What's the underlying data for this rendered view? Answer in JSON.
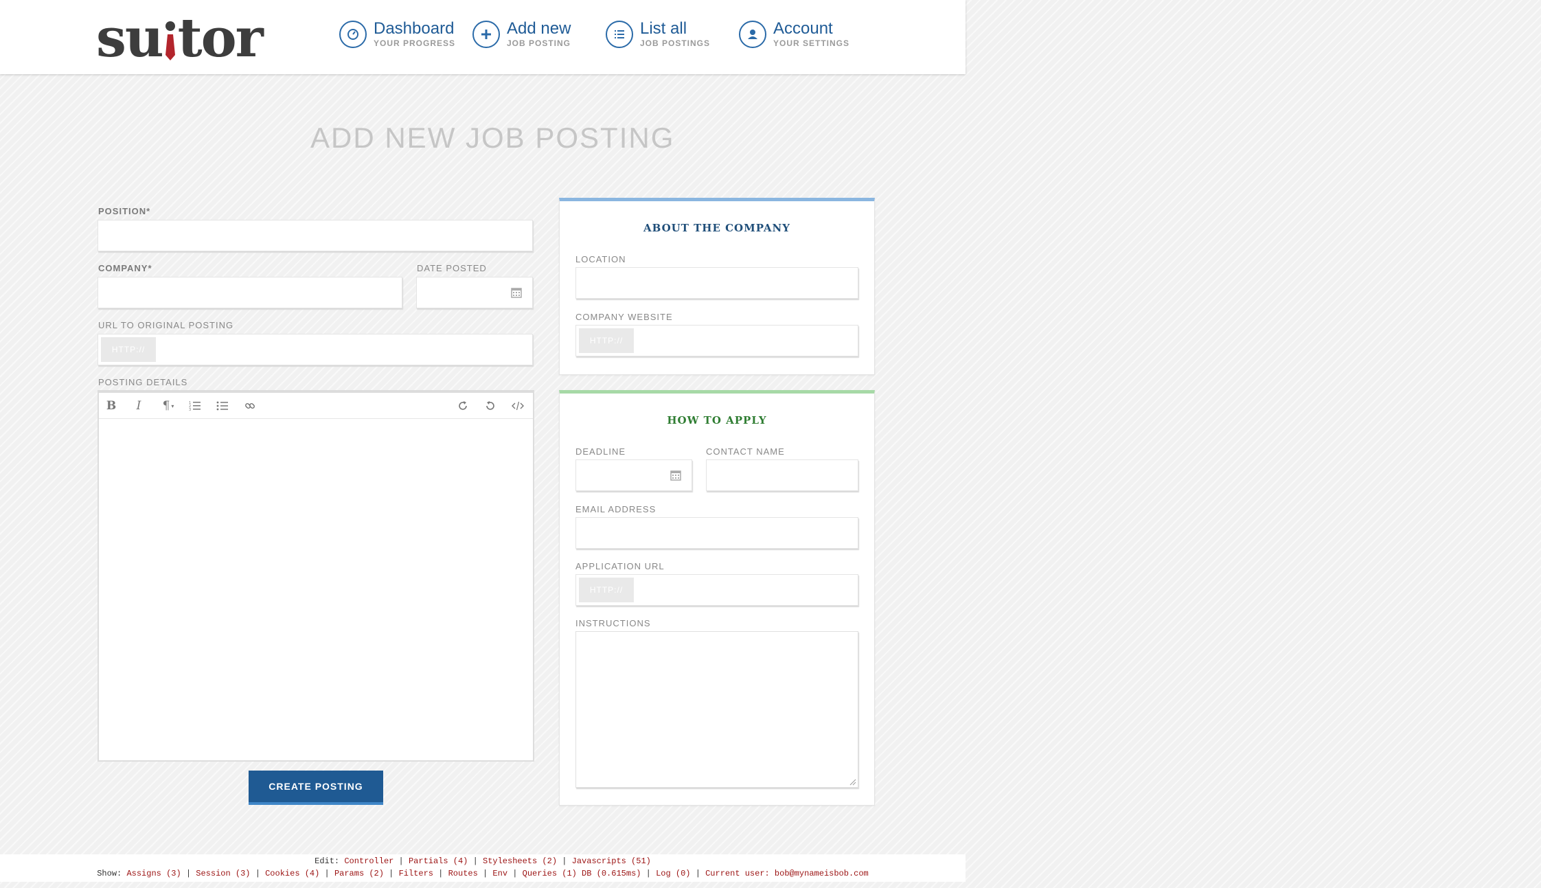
{
  "brand": {
    "logo_text_a": "su",
    "logo_text_b": "tor",
    "logo_accent": "#b3252c"
  },
  "nav": [
    {
      "title": "Dashboard",
      "subtitle": "YOUR PROGRESS",
      "icon": "dashboard-icon"
    },
    {
      "title": "Add new",
      "subtitle": "JOB POSTING",
      "icon": "plus-icon"
    },
    {
      "title": "List all",
      "subtitle": "JOB POSTINGS",
      "icon": "list-icon"
    },
    {
      "title": "Account",
      "subtitle": "YOUR SETTINGS",
      "icon": "user-icon"
    }
  ],
  "page": {
    "title": "ADD NEW JOB POSTING"
  },
  "form": {
    "position_label": "POSITION*",
    "position_value": "",
    "company_label": "COMPANY*",
    "company_value": "",
    "date_posted_label": "DATE POSTED",
    "date_posted_value": "",
    "url_label": "URL TO ORIGINAL POSTING",
    "url_prefix": "HTTP://",
    "url_value": "",
    "details_label": "POSTING DETAILS",
    "details_value": "",
    "toolbar": {
      "bold": "B",
      "italic": "I",
      "paragraph": "¶",
      "icons": [
        "bold-icon",
        "italic-icon",
        "paragraph-icon",
        "ordered-list-icon",
        "unordered-list-icon",
        "link-icon",
        "redo-icon",
        "undo-icon",
        "code-icon"
      ]
    },
    "submit_label": "CREATE POSTING"
  },
  "about_company": {
    "title": "ABOUT THE COMPANY",
    "title_color": "#1f4e79",
    "location_label": "LOCATION",
    "location_value": "",
    "website_label": "COMPANY WEBSITE",
    "website_prefix": "HTTP://",
    "website_value": ""
  },
  "how_to_apply": {
    "title": "HOW TO APPLY",
    "title_color": "#2f7d32",
    "deadline_label": "DEADLINE",
    "deadline_value": "",
    "contact_label": "CONTACT NAME",
    "contact_value": "",
    "email_label": "EMAIL ADDRESS",
    "email_value": "",
    "app_url_label": "APPLICATION URL",
    "app_url_prefix": "HTTP://",
    "app_url_value": "",
    "instructions_label": "INSTRUCTIONS",
    "instructions_value": ""
  },
  "debug_footer": {
    "edit_prefix": "Edit:",
    "edit_links": [
      "Controller",
      "Partials (4)",
      "Stylesheets (2)",
      "Javascripts (51)"
    ],
    "show_prefix": "Show:",
    "show_links": [
      "Assigns (3)",
      "Session (3)",
      "Cookies (4)",
      "Params (2)",
      "Filters",
      "Routes",
      "Env",
      "Queries (1) DB (0.615ms)",
      "Log (0)",
      "Current user: bob@mynameisbob.com"
    ],
    "separator": " | "
  }
}
